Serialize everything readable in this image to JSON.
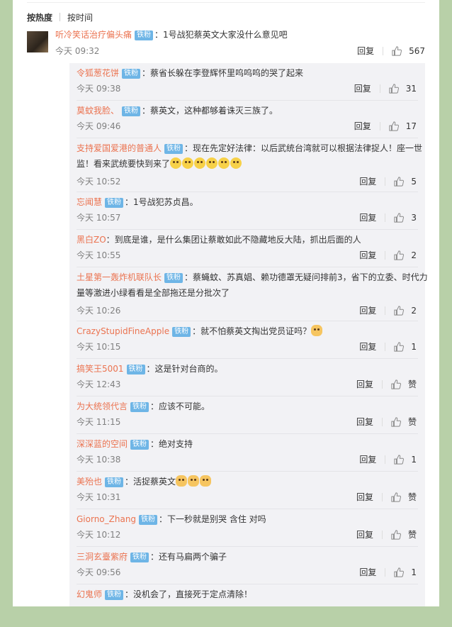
{
  "sort": {
    "hot_label": "按热度",
    "time_label": "按时间"
  },
  "main_comment": {
    "user": "听冷笑话治疗偏头痛",
    "badge": "铁粉",
    "text": "：1号战犯蔡英文大家没什么意见吧",
    "time": "今天 09:32",
    "reply_label": "回复",
    "likes": "567"
  },
  "replies": [
    {
      "user": "令狐葱花饼",
      "badge": "铁粉",
      "text": "：蔡省长躲在李登辉怀里呜呜呜的哭了起来",
      "time": "今天 09:38",
      "reply_label": "回复",
      "likes": "31"
    },
    {
      "user": "莫蚊我脸、",
      "badge": "铁粉",
      "text": "：蔡英文，这种都够着诛灭三族了。",
      "time": "今天 09:46",
      "reply_label": "回复",
      "likes": "17"
    },
    {
      "user": "支持爱国爱港的普通人",
      "badge": "铁粉",
      "text": "：现在先定好法律：以后武统台湾就可以根据法律捉人！座一世",
      "text2": "监！看来武统要快到来了",
      "emojis": [
        "laugh",
        "laugh",
        "laugh",
        "laugh",
        "laugh",
        "laugh"
      ],
      "time": "今天 10:52",
      "reply_label": "回复",
      "likes": "5"
    },
    {
      "user": "忘闻慧",
      "badge": "铁粉",
      "text": "：1号战犯苏贞昌。",
      "time": "今天 10:57",
      "reply_label": "回复",
      "likes": "3"
    },
    {
      "user": "黑白ZO",
      "badge": "",
      "text": "：到底是谁，是什么集团让蔡敢如此不隐藏地反大陆，抓出后面的人",
      "time": "今天 10:55",
      "reply_label": "回复",
      "likes": "2"
    },
    {
      "user": "土星第一轰炸机联队长",
      "badge": "铁粉",
      "text": "：蔡蝇蚊、苏真娼、赖功德罩无疑问排前3，省下的立委、时代力",
      "text2": "量等激进小绿看看是全部拖还是分批次了",
      "time": "今天 10:26",
      "reply_label": "回复",
      "likes": "2"
    },
    {
      "user": "CrazyStupidFineApple",
      "badge": "铁粉",
      "text": "：就不怕蔡英文掏出党员证吗？",
      "emojis": [
        "cat"
      ],
      "time": "今天 10:15",
      "reply_label": "回复",
      "likes": "1"
    },
    {
      "user": "搞笑王5001",
      "badge": "铁粉",
      "text": "：这是针对台商的。",
      "time": "今天 12:43",
      "reply_label": "回复",
      "likes": "赞"
    },
    {
      "user": "为大统领代言",
      "badge": "铁粉",
      "text": "：应该不可能。",
      "time": "今天 11:15",
      "reply_label": "回复",
      "likes": "赞"
    },
    {
      "user": "深深蓝的空间",
      "badge": "铁粉",
      "text": "：绝对支持",
      "time": "今天 10:38",
      "reply_label": "回复",
      "likes": "1"
    },
    {
      "user": "美殆也",
      "badge": "铁粉",
      "text": "：活捉蔡英文",
      "emojis": [
        "cat",
        "cat",
        "cat"
      ],
      "time": "今天 10:31",
      "reply_label": "回复",
      "likes": "赞"
    },
    {
      "user": "Giorno_Zhang",
      "badge": "铁粉",
      "text": "：下一秒就是别哭 含住 对吗",
      "time": "今天 10:12",
      "reply_label": "回复",
      "likes": "赞"
    },
    {
      "user": "三洞玄臺紫府",
      "badge": "铁粉",
      "text": "：还有马扁两个骗子",
      "time": "今天 09:56",
      "reply_label": "回复",
      "likes": "1"
    },
    {
      "user": "幻鬼师",
      "badge": "铁粉",
      "text": "：没机会了，直接死于定点清除！",
      "time": "",
      "reply_label": "",
      "likes": ""
    }
  ]
}
